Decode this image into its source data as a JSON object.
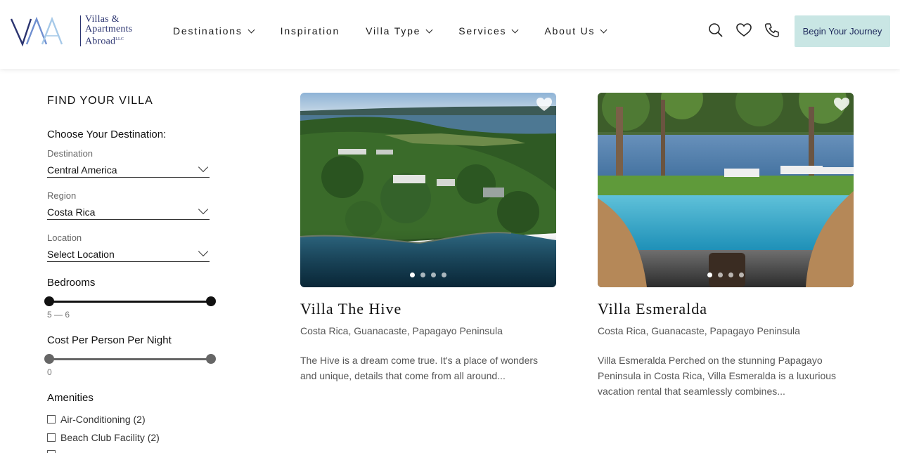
{
  "header": {
    "logo": {
      "monogram": "VAA",
      "lines": [
        "Villas &",
        "Apartments",
        "Abroad"
      ],
      "suffix": "LLC"
    },
    "nav": [
      {
        "label": "Destinations",
        "has_dropdown": true
      },
      {
        "label": "Inspiration",
        "has_dropdown": false
      },
      {
        "label": "Villa Type",
        "has_dropdown": true
      },
      {
        "label": "Services",
        "has_dropdown": true
      },
      {
        "label": "About Us",
        "has_dropdown": true
      }
    ],
    "icons": [
      "search-icon",
      "heart-icon",
      "phone-icon"
    ],
    "cta_label": "Begin Your Journey",
    "cta_color": "#c9e6e4",
    "brand_color": "#2b3470"
  },
  "sidebar": {
    "title": "FIND YOUR VILLA",
    "choose_label": "Choose Your Destination:",
    "destination": {
      "label": "Destination",
      "value": "Central America"
    },
    "region": {
      "label": "Region",
      "value": "Costa Rica"
    },
    "location": {
      "label": "Location",
      "value": "Select Location"
    },
    "bedrooms": {
      "label": "Bedrooms",
      "range_text": "5 — 6",
      "min": 5,
      "max": 6
    },
    "cost": {
      "label": "Cost Per Person Per Night",
      "value_text": "0",
      "value": 0
    },
    "amenities": {
      "label": "Amenities",
      "items": [
        {
          "label": "Air-Conditioning (2)",
          "checked": false
        },
        {
          "label": "Beach Club Facility (2)",
          "checked": false
        }
      ]
    }
  },
  "listings": [
    {
      "name": "Villa The Hive",
      "location": "Costa Rica, Guanacaste, Papagayo Peninsula",
      "description": "The Hive is a dream come true. It's a place of wonders and unique, details that come from all around...",
      "slides": 4,
      "active_slide": 1
    },
    {
      "name": "Villa Esmeralda",
      "location": "Costa Rica, Guanacaste, Papagayo Peninsula",
      "description": "Villa Esmeralda Perched on the stunning Papagayo Peninsula in Costa Rica, Villa Esmeralda is a luxurious vacation rental that seamlessly combines...",
      "slides": 4,
      "active_slide": 1
    }
  ]
}
